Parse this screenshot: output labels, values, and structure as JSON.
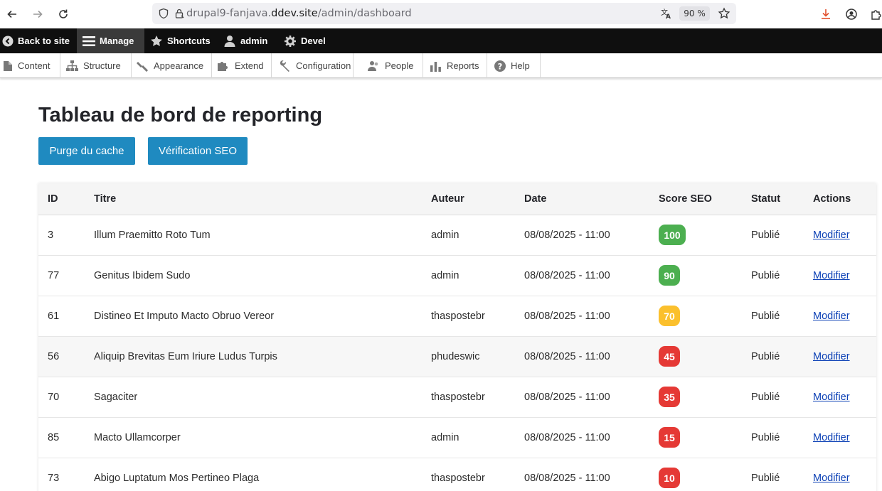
{
  "browser": {
    "url_prefix": "drupal9-fanjava.",
    "url_domain": "ddev.site",
    "url_path": "/admin/dashboard",
    "zoom": "90 %"
  },
  "toolbar": {
    "back": "Back to site",
    "manage": "Manage",
    "shortcuts": "Shortcuts",
    "user": "admin",
    "devel": "Devel"
  },
  "tray": {
    "content": "Content",
    "structure": "Structure",
    "appearance": "Appearance",
    "extend": "Extend",
    "configuration": "Configuration",
    "people": "People",
    "reports": "Reports",
    "help": "Help"
  },
  "page": {
    "title": "Tableau de bord de reporting",
    "purge_button": "Purge du cache",
    "seo_button": "Vérification SEO"
  },
  "table": {
    "headers": {
      "id": "ID",
      "title": "Titre",
      "author": "Auteur",
      "date": "Date",
      "seo": "Score SEO",
      "status": "Statut",
      "actions": "Actions"
    },
    "rows": [
      {
        "id": "3",
        "title": "Illum Praemitto Roto Tum",
        "author": "admin",
        "date": "08/08/2025 - 11:00",
        "seo": "100",
        "status": "Publié",
        "action": "Modifier"
      },
      {
        "id": "77",
        "title": "Genitus Ibidem Sudo",
        "author": "admin",
        "date": "08/08/2025 - 11:00",
        "seo": "90",
        "status": "Publié",
        "action": "Modifier"
      },
      {
        "id": "61",
        "title": "Distineo Et Imputo Macto Obruo Vereor",
        "author": "thaspostebr",
        "date": "08/08/2025 - 11:00",
        "seo": "70",
        "status": "Publié",
        "action": "Modifier"
      },
      {
        "id": "56",
        "title": "Aliquip Brevitas Eum Iriure Ludus Turpis",
        "author": "phudeswic",
        "date": "08/08/2025 - 11:00",
        "seo": "45",
        "status": "Publié",
        "action": "Modifier"
      },
      {
        "id": "70",
        "title": "Sagaciter",
        "author": "thaspostebr",
        "date": "08/08/2025 - 11:00",
        "seo": "35",
        "status": "Publié",
        "action": "Modifier"
      },
      {
        "id": "85",
        "title": "Macto Ullamcorper",
        "author": "admin",
        "date": "08/08/2025 - 11:00",
        "seo": "15",
        "status": "Publié",
        "action": "Modifier"
      },
      {
        "id": "73",
        "title": "Abigo Luptatum Mos Pertineo Plaga",
        "author": "thaspostebr",
        "date": "08/08/2025 - 11:00",
        "seo": "10",
        "status": "Publié",
        "action": "Modifier"
      }
    ]
  },
  "colors": {
    "seo_good": "#4caf50",
    "seo_medium": "#fbc02d",
    "seo_bad": "#e53935",
    "button": "#1f8ac0"
  }
}
